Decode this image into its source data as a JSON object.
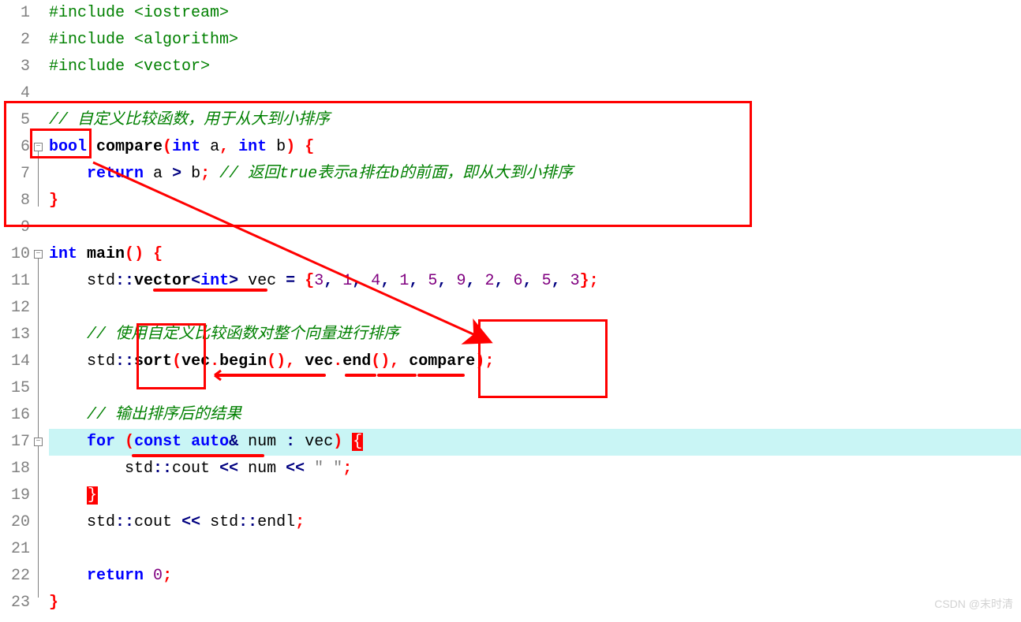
{
  "lines": {
    "1": "1",
    "2": "2",
    "3": "3",
    "4": "4",
    "5": "5",
    "6": "6",
    "7": "7",
    "8": "8",
    "9": "9",
    "10": "10",
    "11": "11",
    "12": "12",
    "13": "13",
    "14": "14",
    "15": "15",
    "16": "16",
    "17": "17",
    "18": "18",
    "19": "19",
    "20": "20",
    "21": "21",
    "22": "22",
    "23": "23"
  },
  "inc1": "#include <iostream>",
  "inc2": "#include <algorithm>",
  "inc3": "#include <vector>",
  "cm5": "// 自定义比较函数，用于从大到小排序",
  "kw_bool": "bool",
  "fn_compare": "compare",
  "kw_int": "int",
  "var_a": "a",
  "var_b": "b",
  "kw_return": "return",
  "op_gt": ">",
  "cm7": "// 返回true表示a排在b的前面，即从大到小排序",
  "fn_main": "main",
  "std": "std",
  "scope": "::",
  "vector": "vector",
  "vec": "vec",
  "eq": "=",
  "nums": {
    "n0": "3",
    "n1": "1",
    "n2": "4",
    "n3": "1",
    "n4": "5",
    "n5": "9",
    "n6": "2",
    "n7": "6",
    "n8": "5",
    "n9": "3"
  },
  "cm13": "// 使用自定义比较函数对整个向量进行排序",
  "sort": "sort",
  "begin": "begin",
  "end": "end",
  "compare_arg": "compare",
  "cm16": "// 输出排序后的结果",
  "kw_for": "for",
  "kw_const": "const",
  "kw_auto": "auto",
  "amp": "&",
  "num_var": "num",
  "colon": ":",
  "cout": "cout",
  "ins": "<<",
  "space_str": "\" \"",
  "endl": "endl",
  "zero": "0",
  "watermark": "CSDN @末时清",
  "lparen": "(",
  "rparen": ")",
  "lbrace": "{",
  "rbrace": "}",
  "lb": "<",
  "rb": ">",
  "semi": ";",
  "comma": ",",
  "dot": "."
}
